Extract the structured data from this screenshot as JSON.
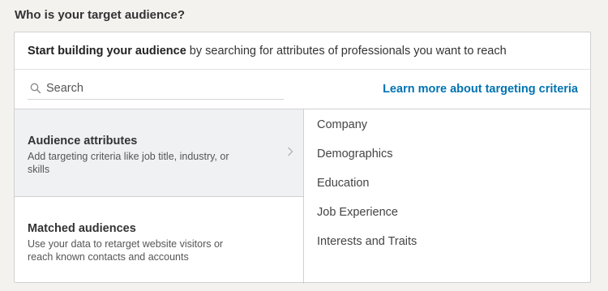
{
  "section_title": "Who is your target audience?",
  "intro": {
    "bold": "Start building your audience",
    "rest": "by searching for attributes of professionals you want to reach"
  },
  "search": {
    "placeholder": "Search",
    "value": ""
  },
  "learn_more": "Learn more about targeting criteria",
  "attribute_groups": [
    {
      "title": "Audience attributes",
      "description": "Add targeting criteria like job title, industry, or skills",
      "selected": true
    },
    {
      "title": "Matched audiences",
      "description": "Use your data to retarget website visitors or reach known contacts and accounts",
      "selected": false
    }
  ],
  "categories": [
    "Company",
    "Demographics",
    "Education",
    "Job Experience",
    "Interests and Traits"
  ],
  "colors": {
    "link": "#0073b1",
    "active_bg": "#f0f1f3",
    "page_bg": "#f3f2ef"
  },
  "icons": {
    "search": "search-icon",
    "chevron": "chevron-right-icon"
  }
}
